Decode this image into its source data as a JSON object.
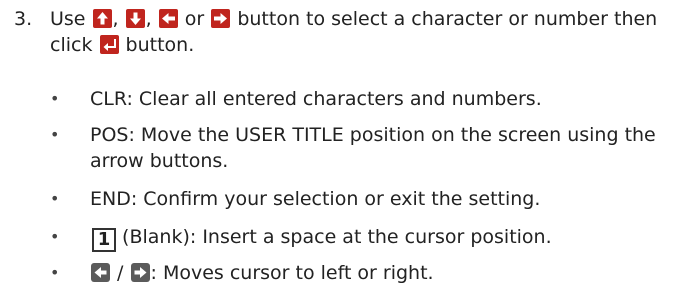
{
  "step": {
    "number": "3.",
    "line1_a": "Use",
    "sep1": ",",
    "sep2": ",",
    "or": "or",
    "line1_b": "button to select a character or number then",
    "line2_a": "click",
    "line2_b": "button."
  },
  "icons": {
    "up": "arrow-up-icon",
    "down": "arrow-down-icon",
    "left": "arrow-left-icon",
    "right": "arrow-right-icon",
    "enter": "enter-icon",
    "cursor_left": "cursor-left-icon",
    "cursor_right": "cursor-right-icon",
    "button_red": "#c0251e",
    "button_gray": "#5b5b5b"
  },
  "bullets": {
    "clr": "CLR: Clear all entered characters and numbers.",
    "pos_line1": "POS: Move the USER TITLE position on the screen using the",
    "pos_line2": "arrow buttons.",
    "end": "END: Confirm your selection or exit the setting.",
    "blank_key": "1",
    "blank_text": "(Blank): Insert a space at the cursor position.",
    "cursor_sep": "/",
    "cursor_text": ": Moves cursor to left or right."
  }
}
